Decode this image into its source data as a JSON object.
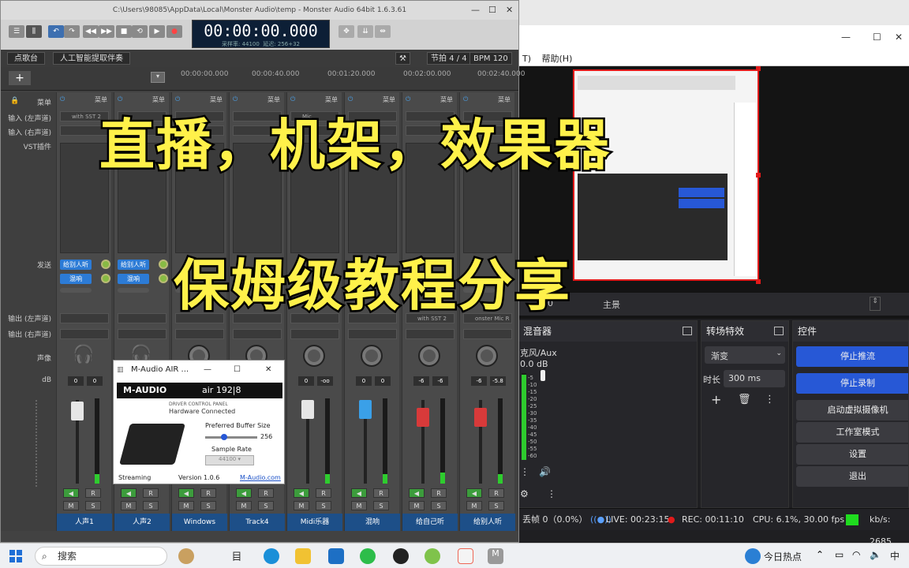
{
  "daw": {
    "title": "C:\\Users\\98085\\AppData\\Local\\Monster Audio\\temp - Monster Audio 64bit 1.6.3.61",
    "timecode": "00:00:00.000",
    "sample_rate_label": "采样率: 44100",
    "latency_label": "延迟: 256+32",
    "tabs": [
      "点歌台",
      "人工智能提取伴奏"
    ],
    "beat_label": "节拍 4 / 4",
    "bpm_label": "BPM 120",
    "add_label": "+",
    "ruler_ticks": [
      "00:00:00.000",
      "00:00:40.000",
      "00:01:20.000",
      "00:02:00.000",
      "00:02:40.000"
    ],
    "row_labels": {
      "menu": "菜单",
      "input_left": "输入 (左声道)",
      "input_right": "输入 (右声道)",
      "vst": "VST插件",
      "send": "发送",
      "output_left": "输出 (左声道)",
      "output_right": "输出 (右声道)",
      "pan": "声像",
      "db": "dB"
    },
    "strips": [
      {
        "name": "人声1",
        "menu": "菜单",
        "input": "with SST 2",
        "send1": "给别人听",
        "send2": "混响",
        "vals": [
          "0",
          "0"
        ],
        "fader": "white"
      },
      {
        "name": "人声2",
        "menu": "菜单",
        "input": "",
        "send1": "给别人听",
        "send2": "混响",
        "vals": [
          "0",
          "0"
        ],
        "fader": "white"
      },
      {
        "name": "Windows",
        "menu": "菜单",
        "input": "",
        "send1": "",
        "send2": "",
        "vals": [
          "0",
          "0"
        ],
        "fader": "white"
      },
      {
        "name": "Track4",
        "menu": "菜单",
        "input": "",
        "send1": "",
        "send2": "",
        "vals": [
          "0",
          "0"
        ],
        "fader": "white"
      },
      {
        "name": "Midi乐器",
        "menu": "菜单",
        "input": "Mic",
        "send1": "",
        "send2": "",
        "vals": [
          "0",
          "-oo"
        ],
        "fader": "white"
      },
      {
        "name": "混响",
        "menu": "菜单",
        "input": "",
        "send1": "",
        "send2": "",
        "vals": [
          "0",
          "0"
        ],
        "fader": "blue"
      },
      {
        "name": "给自己听",
        "menu": "菜单",
        "input": "",
        "send1": "",
        "send2": "",
        "vals": [
          "-6",
          "-6"
        ],
        "fader": "red",
        "output": "with SST 2"
      },
      {
        "name": "给别人听",
        "menu": "菜单",
        "input": "",
        "send1": "",
        "send2": "",
        "vals": [
          "-6",
          "-5.8"
        ],
        "fader": "red",
        "output": "onster Mic R"
      }
    ],
    "mute_label": "M",
    "solo_label": "S",
    "rec_label": "R"
  },
  "maudio": {
    "title": "M-Audio AIR ...",
    "brand": "M-AUDIO",
    "model": "air 192|8",
    "subtitle": "DRIVER CONTROL PANEL",
    "status": "Hardware Connected",
    "buffer_label": "Preferred Buffer Size",
    "buffer_value": "256",
    "rate_label": "Sample Rate",
    "rate_value": "44100",
    "streaming_label": "Streaming",
    "version": "Version 1.0.6",
    "link": "M-Audio.com"
  },
  "obs": {
    "menu_items": [
      "T)",
      "帮助(H)"
    ],
    "scene_text": "主景",
    "scene_prefix": "720",
    "mixer_title": "混音器",
    "mixer_source": "克风/Aux",
    "mixer_db": "0.0 dB",
    "meter_ticks": [
      "-5",
      "-10",
      "-15",
      "-20",
      "-25",
      "-30",
      "-35",
      "-40",
      "-45",
      "-50",
      "-55",
      "-60"
    ],
    "transition_title": "转场特效",
    "transition_value": "渐变",
    "duration_label": "时长",
    "duration_value": "300 ms",
    "controls_title": "控件",
    "controls": [
      "停止推流",
      "停止录制",
      "启动虚拟摄像机",
      "工作室模式",
      "设置",
      "退出"
    ],
    "status": {
      "dropped": "丢帧 0（0.0%）",
      "live": "LIVE: 00:23:15",
      "rec": "REC: 00:11:10",
      "cpu": "CPU: 6.1%, 30.00 fps",
      "kbps": "kb/s: 2685"
    }
  },
  "overlay": {
    "line1": "直播，机架，效果器",
    "line2": "保姆级教程分享"
  },
  "taskbar": {
    "search": "搜索",
    "weather": "今日热点",
    "ime": "中"
  },
  "colors": {
    "accent_blue": "#2758d6",
    "overlay_yellow": "#fff14a",
    "strip_name_bg": "#1d4f88",
    "obs_rec_red": "#e21a1a"
  }
}
